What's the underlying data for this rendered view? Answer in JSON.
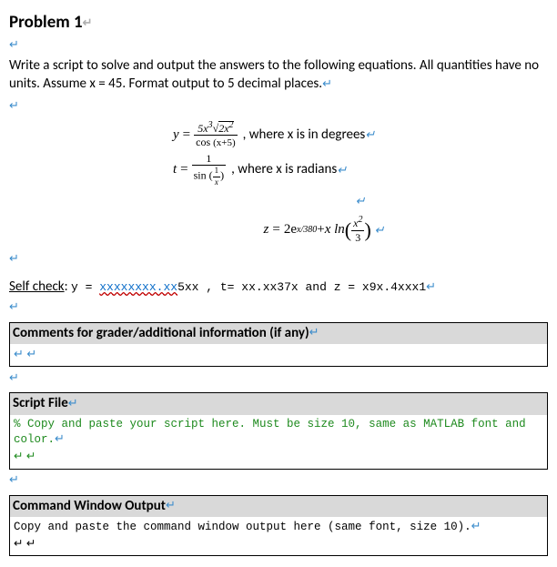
{
  "title": "Problem 1",
  "intro": "Write a script to solve and output the answers to the following equations. All quantities have no units. Assume x = 45. Format output to 5 decimal places.",
  "eq1": {
    "lhs": "y",
    "frac_num_a": "5x",
    "frac_num_sup": "3",
    "frac_num_sqrt": "2x",
    "frac_num_sqrt_sup": "2",
    "frac_den": "cos",
    "frac_den_arg": "(x+5)",
    "note": ", where x is in degrees"
  },
  "eq2": {
    "lhs": "t",
    "frac_num": "1",
    "frac_den_fn": "sin",
    "frac_den_inner_num": "1",
    "frac_den_inner_den": "x",
    "note": ", where x is radians"
  },
  "eq3": {
    "lhs": "z",
    "term1_a": "2e",
    "term1_sup": "x/380",
    "plus": " + ",
    "term2_a": "x ln",
    "term2_inner_num": "x",
    "term2_inner_num_sup": "2",
    "term2_inner_den": "3"
  },
  "selfcheck": {
    "label": "Self check",
    "colon": ": ",
    "y_lhs": "y = ",
    "y_val": "xxxxxxxx.xx",
    "y_suffix": "5xx ,  t= xx.xx37x and z = x9x.4xxx1"
  },
  "comments_header": "Comments for grader/additional information (if any)",
  "script_header": "Script File",
  "script_body": "% Copy and paste your script here. Must be size 10, same as MATLAB font and color.",
  "cmd_header": "Command Window Output",
  "cmd_body": "Copy and paste the command window output here (same font, size 10)."
}
